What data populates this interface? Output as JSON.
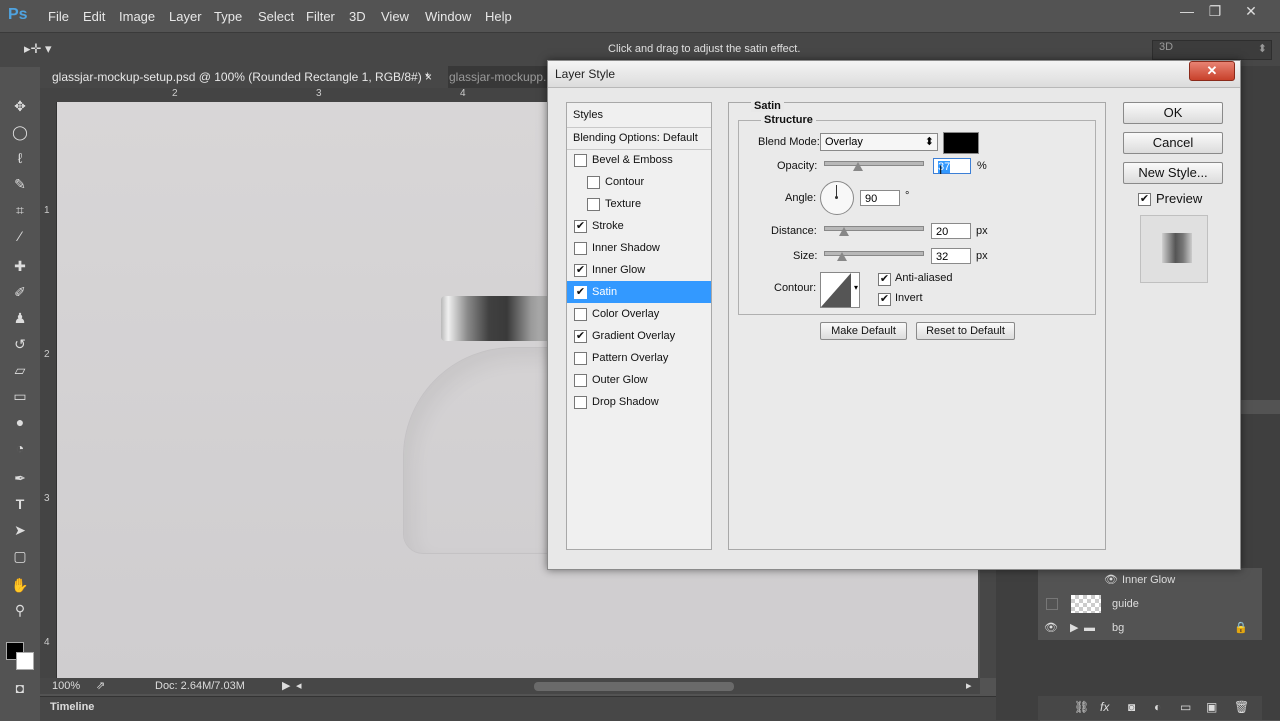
{
  "app": {
    "logo": "Ps"
  },
  "menu": [
    "File",
    "Edit",
    "Image",
    "Layer",
    "Type",
    "Select",
    "Filter",
    "3D",
    "View",
    "Window",
    "Help"
  ],
  "window_controls": {
    "minimize": "—",
    "maximize": "❐",
    "close": "✕"
  },
  "options_bar": {
    "hint": "Click and drag to adjust the satin effect.",
    "workspace": "3D"
  },
  "tabs": [
    {
      "label": "glassjar-mockup-setup.psd @ 100% (Rounded Rectangle 1, RGB/8#) *",
      "close": "×"
    },
    {
      "label": "glassjar-mockupp."
    }
  ],
  "rulers": {
    "top": [
      "2",
      "3",
      "4"
    ],
    "left": [
      "1",
      "2",
      "3",
      "4"
    ]
  },
  "status": {
    "zoom": "100%",
    "doc": "Doc: 2.64M/7.03M"
  },
  "timeline": {
    "label": "Timeline"
  },
  "layers": {
    "effect_row": "Inner Glow",
    "rows": [
      {
        "name": "guide"
      },
      {
        "name": "bg"
      }
    ]
  },
  "dialog": {
    "title": "Layer Style",
    "close": "✕",
    "styles_header": "Styles",
    "blending": "Blending Options: Default",
    "items": [
      {
        "label": "Bevel & Emboss",
        "checked": false,
        "indent": false
      },
      {
        "label": "Contour",
        "checked": false,
        "indent": true
      },
      {
        "label": "Texture",
        "checked": false,
        "indent": true
      },
      {
        "label": "Stroke",
        "checked": true,
        "indent": false
      },
      {
        "label": "Inner Shadow",
        "checked": false,
        "indent": false
      },
      {
        "label": "Inner Glow",
        "checked": true,
        "indent": false
      },
      {
        "label": "Satin",
        "checked": true,
        "indent": false,
        "selected": true
      },
      {
        "label": "Color Overlay",
        "checked": false,
        "indent": false
      },
      {
        "label": "Gradient Overlay",
        "checked": true,
        "indent": false
      },
      {
        "label": "Pattern Overlay",
        "checked": false,
        "indent": false
      },
      {
        "label": "Outer Glow",
        "checked": false,
        "indent": false
      },
      {
        "label": "Drop Shadow",
        "checked": false,
        "indent": false
      }
    ],
    "satin": {
      "title": "Satin",
      "structure": "Structure",
      "blend_mode_label": "Blend Mode:",
      "blend_mode": "Overlay",
      "color": "#000000",
      "opacity_label": "Opacity:",
      "opacity": "37",
      "opacity_unit": "%",
      "opacity_fraction": 0.35,
      "angle_label": "Angle:",
      "angle": "90",
      "angle_unit": "°",
      "distance_label": "Distance:",
      "distance": "20",
      "distance_unit": "px",
      "distance_fraction": 0.2,
      "size_label": "Size:",
      "size": "32",
      "size_unit": "px",
      "size_fraction": 0.18,
      "contour_label": "Contour:",
      "anti_aliased": "Anti-aliased",
      "invert": "Invert",
      "make_default": "Make Default",
      "reset_default": "Reset to Default"
    },
    "buttons": {
      "ok": "OK",
      "cancel": "Cancel",
      "new_style": "New Style...",
      "preview": "Preview"
    }
  }
}
